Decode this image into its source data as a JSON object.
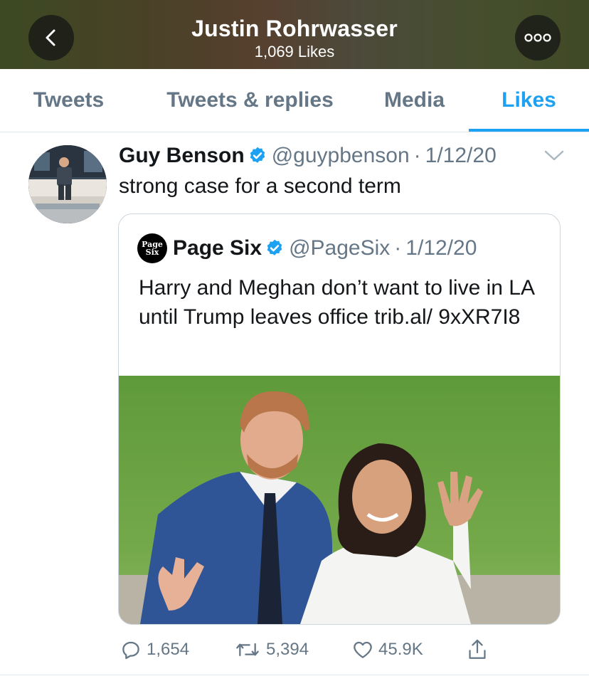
{
  "header": {
    "title": "Justin Rohrwasser",
    "subtitle": "1,069 Likes",
    "back_icon": "chevron-left-icon",
    "more_icon": "ellipsis-icon"
  },
  "tabs": [
    {
      "label": "Tweets",
      "active": false
    },
    {
      "label": "Tweets & replies",
      "active": false
    },
    {
      "label": "Media",
      "active": false
    },
    {
      "label": "Likes",
      "active": true
    }
  ],
  "tweet": {
    "author_name": "Guy Benson",
    "verified": true,
    "handle": "@guypbenson",
    "separator": "·",
    "date": "1/12/20",
    "text": "strong case for a second term",
    "quote": {
      "logo_text_1": "Page",
      "logo_text_2": "Six",
      "author_name": "Page Six",
      "verified": true,
      "handle": "@PageSix",
      "separator": "·",
      "date": "1/12/20",
      "text": "Harry and Meghan don’t want to live in LA until Trump leaves office trib.al/ 9xXR7I8"
    },
    "stats": {
      "replies": "1,654",
      "retweets": "5,394",
      "likes": "45.9K"
    }
  },
  "colors": {
    "accent": "#1da1f2",
    "muted": "#657786",
    "text": "#14171a"
  }
}
